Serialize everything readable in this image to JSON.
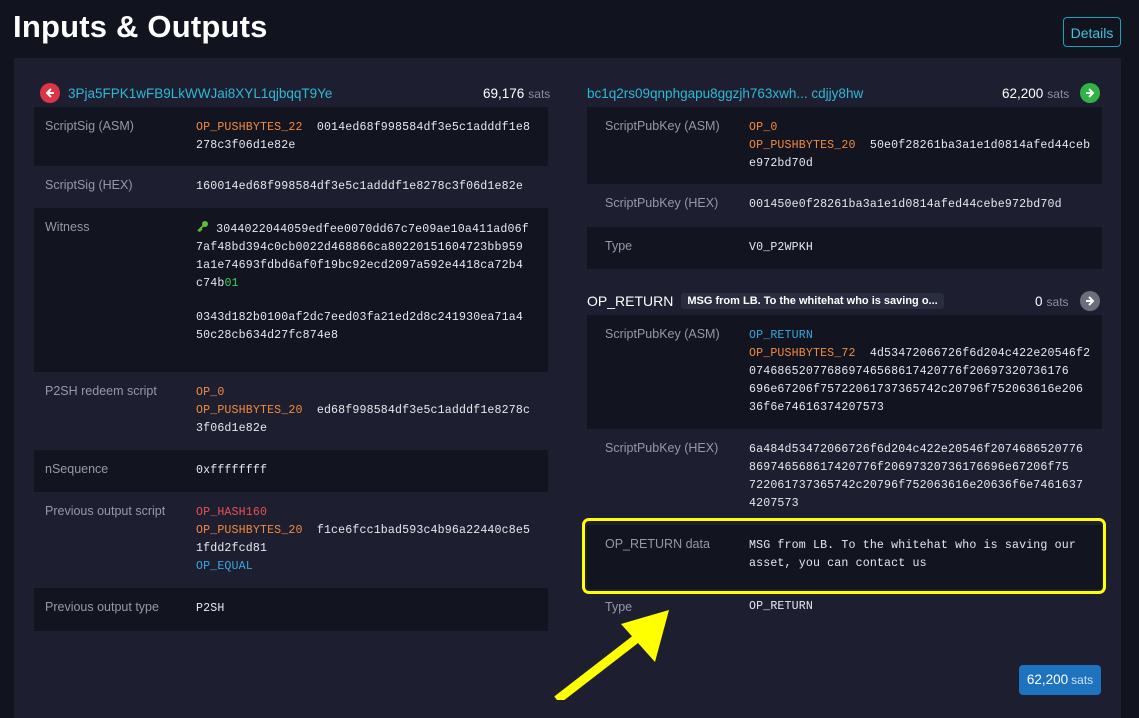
{
  "header": {
    "title": "Inputs & Outputs",
    "details_button": "Details"
  },
  "input": {
    "address": "3Pja5FPK1wFB9LkWWJai8XYL1qjbqqT9Ye",
    "amount": "69,176",
    "unit": "sats",
    "scriptsig_asm_label": "ScriptSig (ASM)",
    "scriptsig_asm_op": "OP_PUSHBYTES_22",
    "scriptsig_asm_data_1": "0014ed68f998584df3e5c1adddf1e8",
    "scriptsig_asm_data_2": "278c3f06d1e82e",
    "scriptsig_hex_label": "ScriptSig (HEX)",
    "scriptsig_hex": "160014ed68f998584df3e5c1adddf1e8278c3f06d1e82e",
    "witness_label": "Witness",
    "witness_1_line_1": "3044022044059edfee0070dd67c7e09ae10a411ad06f",
    "witness_1_line_2": "7af48bd394c0cb0022d468866ca80220151604723bb959",
    "witness_1_line_3": "1a1e74693fdbd6af0f19bc92ecd2097a592e4418ca72b4",
    "witness_1_line_4": "c74b",
    "witness_1_sighash": "01",
    "witness_2_line_1": "0343d182b0100af2dc7eed03fa21ed2d8c241930ea71a4",
    "witness_2_line_2": "50c28cb634d27fc874e8",
    "p2sh_label": "P2SH redeem script",
    "p2sh_op_1": "OP_0",
    "p2sh_op_2": "OP_PUSHBYTES_20",
    "p2sh_data_1": "ed68f998584df3e5c1adddf1e8278c",
    "p2sh_data_2": "3f06d1e82e",
    "nsequence_label": "nSequence",
    "nsequence": "0xffffffff",
    "prev_script_label": "Previous output script",
    "prev_op_1": "OP_HASH160",
    "prev_op_2": "OP_PUSHBYTES_20",
    "prev_data_1": "f1ce6fcc1bad593c4b96a22440c8e5",
    "prev_data_2": "1fdd2fcd81",
    "prev_op_3": "OP_EQUAL",
    "prev_type_label": "Previous output type",
    "prev_type": "P2SH"
  },
  "output_1": {
    "address": "bc1q2rs09qnphgapu8ggzjh763xwh...  cdjjy8hw",
    "amount": "62,200",
    "unit": "sats",
    "pubkey_asm_label": "ScriptPubKey (ASM)",
    "pubkey_asm_op_1": "OP_0",
    "pubkey_asm_op_2": "OP_PUSHBYTES_20",
    "pubkey_asm_data_1": "50e0f28261ba3a1e1d0814afed44ceb",
    "pubkey_asm_data_2": "e972bd70d",
    "pubkey_hex_label": "ScriptPubKey (HEX)",
    "pubkey_hex": "001450e0f28261ba3a1e1d0814afed44cebe972bd70d",
    "type_label": "Type",
    "type": "V0_P2WPKH"
  },
  "output_2": {
    "label": "OP_RETURN",
    "badge": "MSG from LB. To the whitehat who is saving o...",
    "amount": "0",
    "unit": "sats",
    "pubkey_asm_label": "ScriptPubKey (ASM)",
    "pubkey_asm_op_1": "OP_RETURN",
    "pubkey_asm_op_2": "OP_PUSHBYTES_72",
    "pubkey_asm_data_1": "4d53472066726f6d204c422e20546f2",
    "pubkey_asm_data_2": "074686520776869746568617420776f20697320736176",
    "pubkey_asm_data_3": "696e67206f75722061737365742c20796f752063616e206",
    "pubkey_asm_data_4": "36f6e74616374207573",
    "pubkey_hex_label": "ScriptPubKey (HEX)",
    "pubkey_hex_1": "6a484d53472066726f6d204c422e20546f2074686520776",
    "pubkey_hex_2": "869746568617420776f20697320736176696e67206f75",
    "pubkey_hex_3": "722061737365742c20796f752063616e20636f6e7461637",
    "pubkey_hex_4": "4207573",
    "opreturn_data_label": "OP_RETURN data",
    "opreturn_data_1": "MSG from LB. To the whitehat who is saving our",
    "opreturn_data_2": "asset, you can contact us",
    "type_label": "Type",
    "type": "OP_RETURN"
  },
  "footer": {
    "total": "62,200",
    "unit": "sats"
  },
  "colors": {
    "accent": "#2fb8d6",
    "opcode": "#f28a3c",
    "highlight": "#ffff00",
    "badge": "#1e73be"
  },
  "icons": {
    "input_arrow": "arrow-left-icon",
    "output_arrow": "arrow-right-icon",
    "key": "key-icon"
  }
}
